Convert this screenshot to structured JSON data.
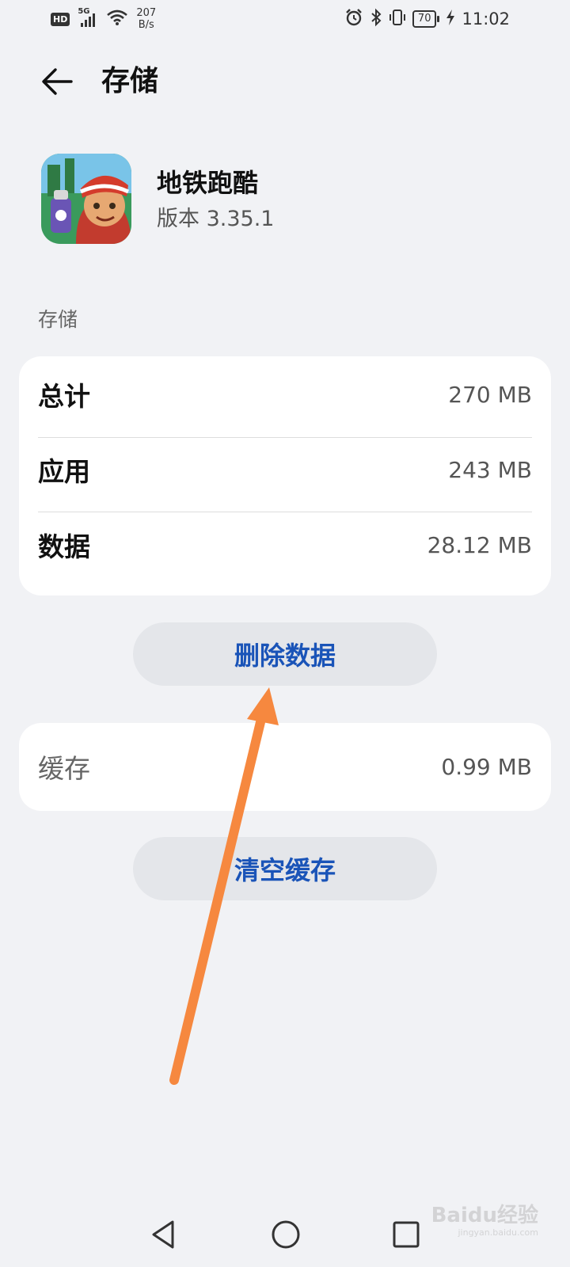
{
  "status_bar": {
    "hd": "HD",
    "network": "5G",
    "speed_value": "207",
    "speed_unit": "B/s",
    "battery": "70",
    "time": "11:02"
  },
  "header": {
    "title": "存储"
  },
  "app": {
    "name": "地铁跑酷",
    "version": "版本 3.35.1"
  },
  "storage": {
    "section_label": "存储",
    "rows": [
      {
        "label": "总计",
        "value": "270 MB"
      },
      {
        "label": "应用",
        "value": "243 MB"
      },
      {
        "label": "数据",
        "value": "28.12 MB"
      }
    ],
    "delete_button": "删除数据"
  },
  "cache": {
    "label": "缓存",
    "value": "0.99 MB",
    "clear_button": "清空缓存"
  },
  "watermark": {
    "main": "Baidu经验",
    "sub": "jingyan.baidu.com"
  },
  "colors": {
    "accent": "#1a54b8",
    "arrow": "#f6883f",
    "background": "#f1f2f5"
  }
}
